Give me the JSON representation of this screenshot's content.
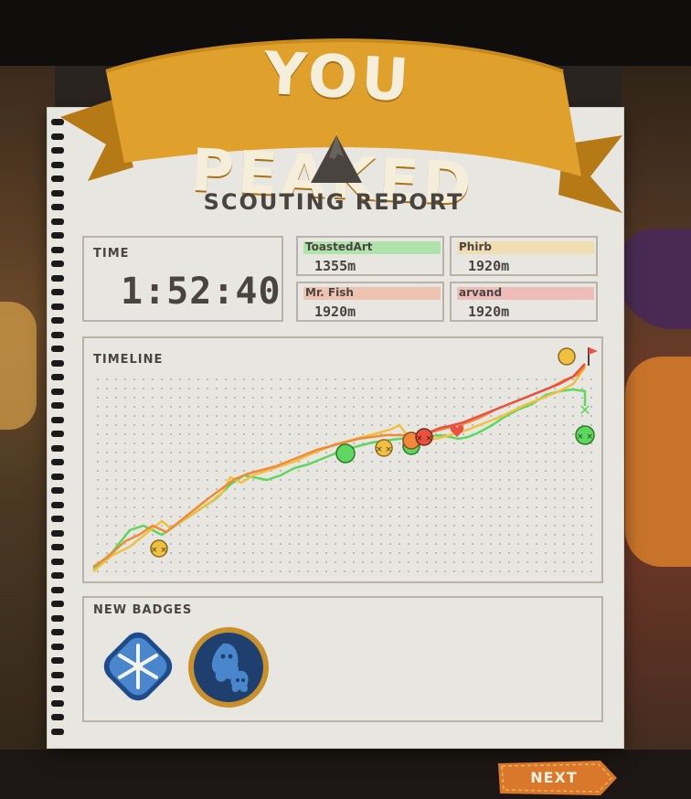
{
  "banner": {
    "title": "YOU PEAKED"
  },
  "report": {
    "title": "SCOUTING REPORT"
  },
  "time": {
    "label": "TIME",
    "value": "1:52:40"
  },
  "players": [
    {
      "name": "ToastedArt",
      "altitude": "1355m",
      "color": "#5fd65f"
    },
    {
      "name": "Phirb",
      "altitude": "1920m",
      "color": "#f0c86a"
    },
    {
      "name": "Mr. Fish",
      "altitude": "1920m",
      "color": "#f08a6a"
    },
    {
      "name": "arvand",
      "altitude": "1920m",
      "color": "#f07a7a"
    }
  ],
  "timeline": {
    "label": "TIMELINE",
    "colors": {
      "green": "#5fd65f",
      "yellow": "#f0c040",
      "orange": "#f08a3a",
      "red": "#e85040"
    }
  },
  "badges": {
    "label": "NEW BADGES",
    "items": [
      {
        "icon": "snowflake-badge-icon"
      },
      {
        "icon": "ghosts-badge-icon"
      }
    ]
  },
  "next": {
    "label": "NEXT"
  },
  "colors": {
    "banner": "#e0a12c",
    "paper": "#e8e6e0",
    "ink": "#4a4440",
    "next": "#d9772a"
  }
}
